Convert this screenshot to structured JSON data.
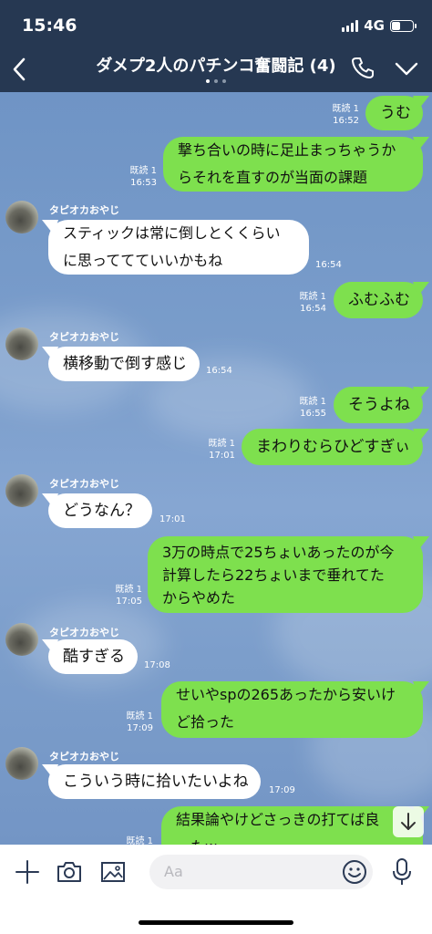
{
  "status": {
    "time": "15:46",
    "network": "4G"
  },
  "header": {
    "title": "ダメプ2人のパチンコ奮闘記 (4)"
  },
  "messages": [
    {
      "id": "m1",
      "from": "me",
      "text": "うむ",
      "read": "既読 1",
      "time": "16:52"
    },
    {
      "id": "m2",
      "from": "me",
      "lines": [
        "撃ち合いの時に足止まっちゃうか",
        "らそれを直すのが当面の課題"
      ],
      "read": "既読 1",
      "time": "16:53"
    },
    {
      "id": "m3",
      "from": "them",
      "sender": "タピオカおやじ",
      "lines": [
        "スティックは常に倒しとくくらい",
        "に思っててていいかもね"
      ],
      "time": "16:54"
    },
    {
      "id": "m4",
      "from": "me",
      "text": "ふむふむ",
      "read": "既読 1",
      "time": "16:54"
    },
    {
      "id": "m5",
      "from": "them",
      "sender": "タピオカおやじ",
      "text": "横移動で倒す感じ",
      "time": "16:54"
    },
    {
      "id": "m6",
      "from": "me",
      "text": "そうよね",
      "read": "既読 1",
      "time": "16:55"
    },
    {
      "id": "m7",
      "from": "me",
      "text": "まわりむらひどすぎぃ",
      "read": "既読 1",
      "time": "17:01"
    },
    {
      "id": "m8",
      "from": "them",
      "sender": "タピオカおやじ",
      "text": "どうなん？",
      "time": "17:01"
    },
    {
      "id": "m9",
      "from": "me",
      "lines": [
        "3万の時点で25ちょいあったのが今",
        "計算したら22ちょいまで垂れてた",
        "からやめた"
      ],
      "read": "既読 1",
      "time": "17:05"
    },
    {
      "id": "m10",
      "from": "them",
      "sender": "タピオカおやじ",
      "text": "酷すぎる",
      "time": "17:08"
    },
    {
      "id": "m11",
      "from": "me",
      "lines": [
        "せいやspの265あったから安いけ",
        "ど拾った"
      ],
      "read": "既読 1",
      "time": "17:09"
    },
    {
      "id": "m12",
      "from": "them",
      "sender": "タピオカおやじ",
      "text": "こういう時に拾いたいよね",
      "time": "17:09"
    },
    {
      "id": "m13",
      "from": "me",
      "lines": [
        "結果論やけどさっきの打てば良",
        "ったw"
      ],
      "read": "既読 1",
      "time": ""
    }
  ],
  "input": {
    "placeholder": "Aa"
  },
  "icons": {
    "back": "chevron-left-icon",
    "call": "phone-icon",
    "menu": "chevron-down-icon",
    "add": "plus-icon",
    "camera": "camera-icon",
    "image": "image-icon",
    "emoji": "emoji-icon",
    "mic": "microphone-icon",
    "scroll": "arrow-down-icon"
  },
  "colors": {
    "header": "#263852",
    "my_bubble": "#7ee04e",
    "their_bubble": "#ffffff",
    "chat_background": "#7a9dcb"
  }
}
